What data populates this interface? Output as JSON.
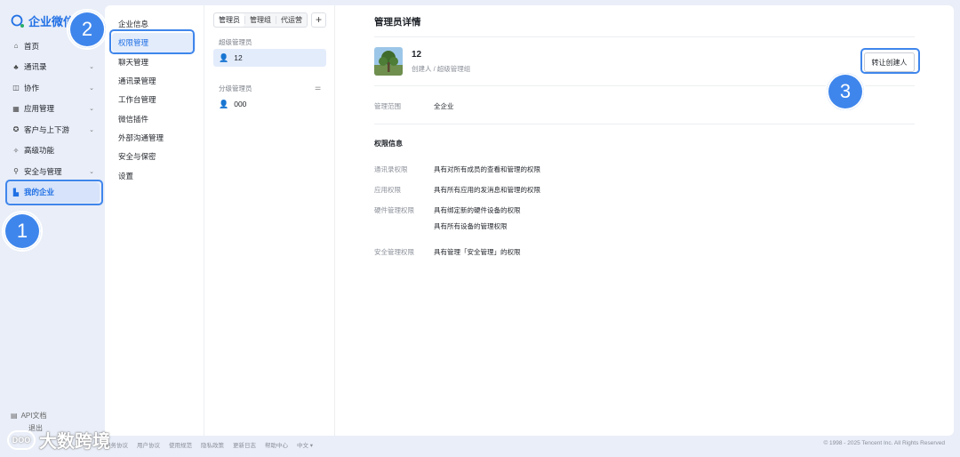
{
  "app": {
    "name": "企业微信"
  },
  "sidebar": {
    "items": [
      {
        "label": "首页",
        "icon": "home-icon",
        "chevron": false
      },
      {
        "label": "通讯录",
        "icon": "org-icon",
        "chevron": true
      },
      {
        "label": "协作",
        "icon": "collab-icon",
        "chevron": true
      },
      {
        "label": "应用管理",
        "icon": "apps-icon",
        "chevron": true
      },
      {
        "label": "客户与上下游",
        "icon": "customer-icon",
        "chevron": true
      },
      {
        "label": "高级功能",
        "icon": "advanced-icon",
        "chevron": false
      },
      {
        "label": "安全与管理",
        "icon": "security-icon",
        "chevron": true
      },
      {
        "label": "我的企业",
        "icon": "enterprise-icon",
        "chevron": false,
        "active": true
      }
    ],
    "bottom": {
      "api_doc": "API文档",
      "logout": "退出"
    }
  },
  "submenu": {
    "items": [
      {
        "label": "企业信息"
      },
      {
        "label": "权限管理",
        "active": true
      },
      {
        "label": "聊天管理"
      },
      {
        "label": "通讯录管理"
      },
      {
        "label": "工作台管理"
      },
      {
        "label": "微信插件"
      },
      {
        "label": "外部沟通管理"
      },
      {
        "label": "安全与保密"
      },
      {
        "label": "设置"
      }
    ]
  },
  "admins": {
    "tabs": [
      "管理员",
      "管理组",
      "代运营"
    ],
    "add_label": "+",
    "super_group_label": "超级管理员",
    "super_members": [
      "12"
    ],
    "branch_group_label": "分级管理员",
    "branch_members": [
      "000"
    ]
  },
  "detail": {
    "title": "管理员详情",
    "name": "12",
    "role": "创建人 / 超级管理组",
    "transfer_button": "转让创建人",
    "scope_label": "管理范围",
    "scope_value": "全企业",
    "permissions_title": "权限信息",
    "permissions": [
      {
        "label": "通讯录权限",
        "values": [
          "具有对所有成员的查看和管理的权限"
        ]
      },
      {
        "label": "应用权限",
        "values": [
          "具有所有应用的发消息和管理的权限"
        ]
      },
      {
        "label": "硬件管理权限",
        "values": [
          "具有绑定新的硬件设备的权限",
          "具有所有设备的管理权限"
        ]
      },
      {
        "label": "安全管理权限",
        "values": [
          "具有管理「安全管理」的权限"
        ]
      }
    ]
  },
  "footer": {
    "links": [
      "服务协议",
      "用户协议",
      "使用规范",
      "隐私政策",
      "更新日志",
      "帮助中心",
      "中文 ▾"
    ],
    "copyright": "© 1998 - 2025 Tencent Inc. All Rights Reserved"
  },
  "watermark": {
    "logo_text": "DOO",
    "text": "大数跨境"
  },
  "annotations": {
    "badge1": "1",
    "badge2": "2",
    "badge3": "3"
  },
  "colors": {
    "accent": "#1f6fe5",
    "badge": "#3f86ec",
    "selected_bg": "#e3ecfb"
  }
}
